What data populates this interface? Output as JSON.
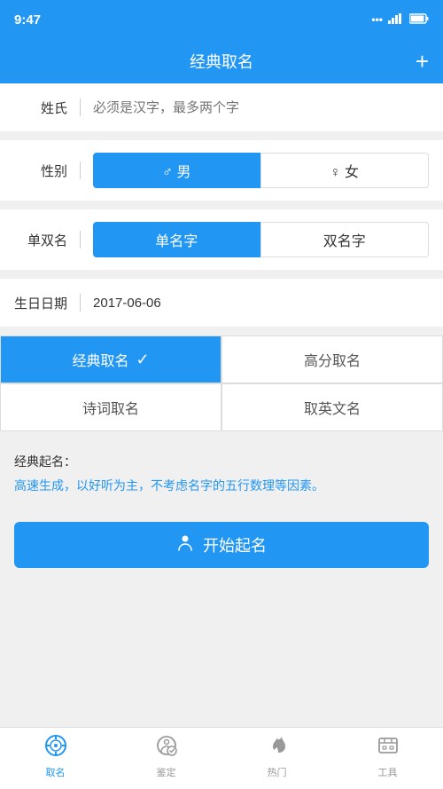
{
  "statusBar": {
    "time": "9:47",
    "icons": "... .ill □"
  },
  "header": {
    "title": "经典取名",
    "addButton": "+"
  },
  "form": {
    "surname": {
      "label": "姓氏",
      "placeholder": "必须是汉字，最多两个字"
    },
    "gender": {
      "label": "性别",
      "maleLabel": "♂ 男",
      "femaleLabel": "♀ 女",
      "selected": "male"
    },
    "nameType": {
      "label": "单双名",
      "singleLabel": "单名字",
      "doubleLabel": "双名字",
      "selected": "single"
    },
    "birthday": {
      "label": "生日日期",
      "value": "2017-06-06"
    }
  },
  "namingTypes": {
    "classic": "经典取名",
    "highScore": "高分取名",
    "poem": "诗词取名",
    "english": "取英文名",
    "selected": "classic"
  },
  "description": {
    "title": "经典起名：",
    "body": "高速生成，以好听为主，不考虑名字的五行数理等因素。"
  },
  "startButton": {
    "label": "开始起名"
  },
  "bottomNav": {
    "items": [
      {
        "id": "naming",
        "label": "取名",
        "active": true
      },
      {
        "id": "appraise",
        "label": "鉴定",
        "active": false
      },
      {
        "id": "hot",
        "label": "热门",
        "active": false
      },
      {
        "id": "tools",
        "label": "工具",
        "active": false
      }
    ]
  }
}
